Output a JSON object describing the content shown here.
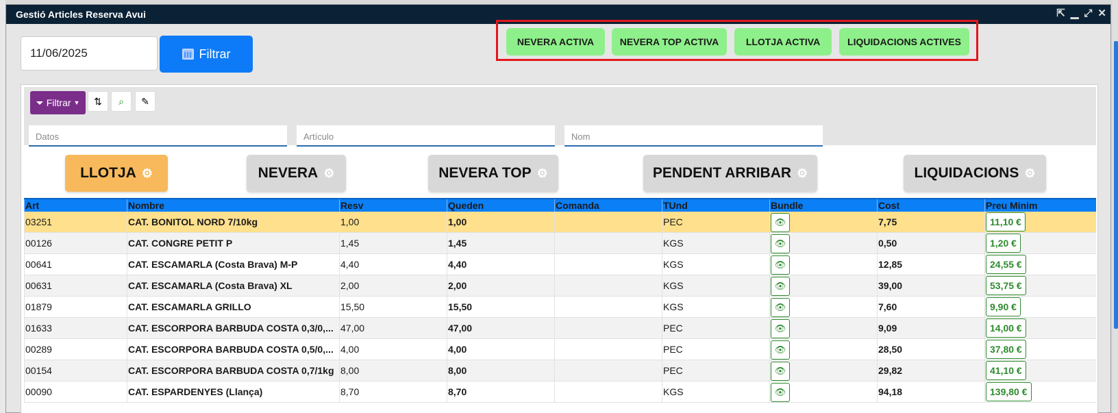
{
  "window": {
    "title": "Gestió Articles Reserva Avui"
  },
  "filters": {
    "date": "11/06/2025",
    "filter_button": "Filtrar"
  },
  "quick_buttons": [
    "NEVERA ACTIVA",
    "NEVERA TOP ACTIVA",
    "LLOTJA ACTIVA",
    "LIQUIDACIONS ACTIVES"
  ],
  "toolbar": {
    "filter_label": "Filtrar"
  },
  "search_fields": {
    "datos": "Datos",
    "articulo": "Artículo",
    "nom": "Nom"
  },
  "tabs": [
    "LLOTJA",
    "NEVERA",
    "NEVERA TOP",
    "PENDENT ARRIBAR",
    "LIQUIDACIONS"
  ],
  "grid": {
    "columns": [
      "Art",
      "Nombre",
      "Resv",
      "Queden",
      "Comanda",
      "TUnd",
      "Bundle",
      "Cost",
      "Preu Minim"
    ],
    "rows": [
      {
        "art": "03251",
        "nombre": "CAT. BONITOL NORD 7/10kg",
        "resv": "1,00",
        "queden": "1,00",
        "comanda": "",
        "tund": "PEC",
        "cost": "7,75",
        "preu": "11,10 €"
      },
      {
        "art": "00126",
        "nombre": "CAT. CONGRE PETIT P",
        "resv": "1,45",
        "queden": "1,45",
        "comanda": "",
        "tund": "KGS",
        "cost": "0,50",
        "preu": "1,20 €"
      },
      {
        "art": "00641",
        "nombre": "CAT. ESCAMARLA (Costa Brava) M-P",
        "resv": "4,40",
        "queden": "4,40",
        "comanda": "",
        "tund": "KGS",
        "cost": "12,85",
        "preu": "24,55 €"
      },
      {
        "art": "00631",
        "nombre": "CAT. ESCAMARLA (Costa Brava) XL",
        "resv": "2,00",
        "queden": "2,00",
        "comanda": "",
        "tund": "KGS",
        "cost": "39,00",
        "preu": "53,75 €"
      },
      {
        "art": "01879",
        "nombre": "CAT. ESCAMARLA GRILLO",
        "resv": "15,50",
        "queden": "15,50",
        "comanda": "",
        "tund": "KGS",
        "cost": "7,60",
        "preu": "9,90 €"
      },
      {
        "art": "01633",
        "nombre": "CAT. ESCORPORA BARBUDA COSTA 0,3/0,...",
        "resv": "47,00",
        "queden": "47,00",
        "comanda": "",
        "tund": "PEC",
        "cost": "9,09",
        "preu": "14,00 €"
      },
      {
        "art": "00289",
        "nombre": "CAT. ESCORPORA BARBUDA COSTA 0,5/0,...",
        "resv": "4,00",
        "queden": "4,00",
        "comanda": "",
        "tund": "PEC",
        "cost": "28,50",
        "preu": "37,80 €"
      },
      {
        "art": "00154",
        "nombre": "CAT. ESCORPORA BARBUDA COSTA 0,7/1kg",
        "resv": "8,00",
        "queden": "8,00",
        "comanda": "",
        "tund": "PEC",
        "cost": "29,82",
        "preu": "41,10 €"
      },
      {
        "art": "00090",
        "nombre": "CAT. ESPARDENYES (Llança)",
        "resv": "8,70",
        "queden": "8,70",
        "comanda": "",
        "tund": "KGS",
        "cost": "94,18",
        "preu": "139,80 €"
      }
    ]
  },
  "icons": {
    "bundle": "eye-icon",
    "sort": "sort-az-icon",
    "search": "search-icon",
    "clear": "brush-icon",
    "tab": "gear-icon"
  },
  "colors": {
    "titlebar": "#0b2236",
    "filter_button": "#0d7bf7",
    "quick_buttons": "#8ef08a",
    "active_tab": "#f7b95c",
    "grid_header": "#0b7ff5",
    "selected_row": "#ffe08d",
    "toolbar_filter": "#7b2d8a",
    "highlight_box": "#e4161b"
  }
}
